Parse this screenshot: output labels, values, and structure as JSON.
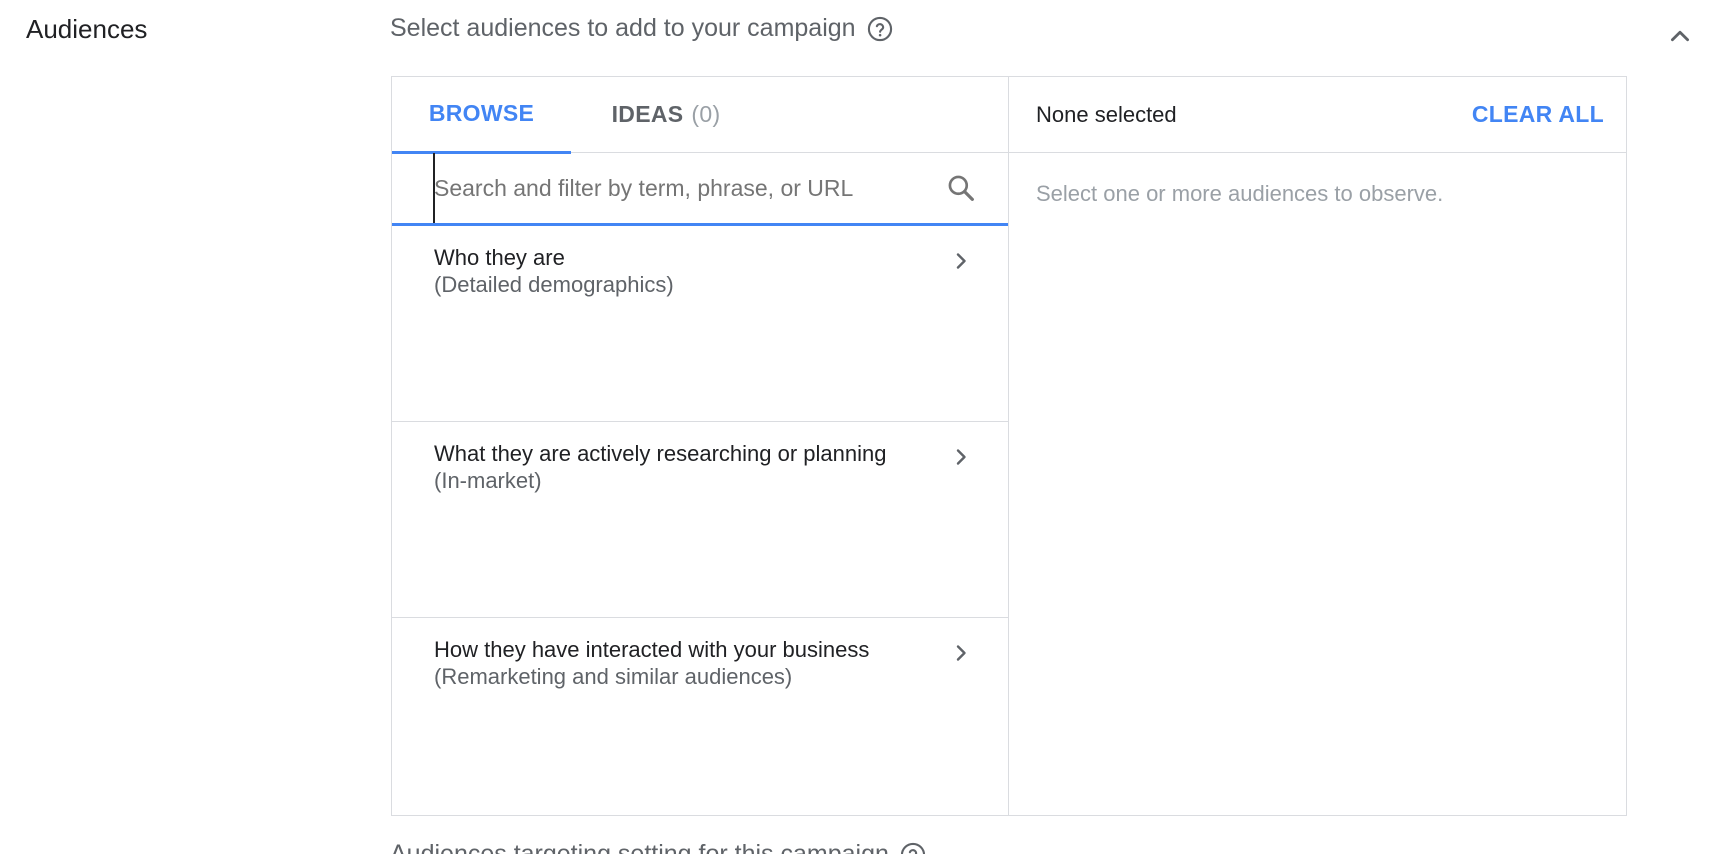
{
  "section": {
    "title": "Audiences",
    "subtitle": "Select audiences to add to your campaign",
    "help_icon": "help-circle-icon",
    "collapse_icon": "chevron-up-icon"
  },
  "tabs": [
    {
      "label": "BROWSE",
      "active": true
    },
    {
      "label": "IDEAS",
      "count": "(0)",
      "active": false
    }
  ],
  "search": {
    "placeholder": "Search and filter by term, phrase, or URL",
    "value": "",
    "icon": "search-icon"
  },
  "categories": [
    {
      "title": "Who they are",
      "subtitle": "(Detailed demographics)"
    },
    {
      "title": "What they are actively researching or planning",
      "subtitle": "(In-market)"
    },
    {
      "title": "How they have interacted with your business",
      "subtitle": "(Remarketing and similar audiences)"
    }
  ],
  "selection": {
    "status": "None selected",
    "clear_all_label": "CLEAR ALL",
    "empty_message": "Select one or more audiences to observe."
  },
  "footer": {
    "text": "Audiences targeting setting for this campaign"
  },
  "colors": {
    "accent": "#4285f4",
    "border": "#dadce0",
    "text_primary": "#202124",
    "text_secondary": "#5f6368",
    "text_muted": "#9aa0a6"
  }
}
